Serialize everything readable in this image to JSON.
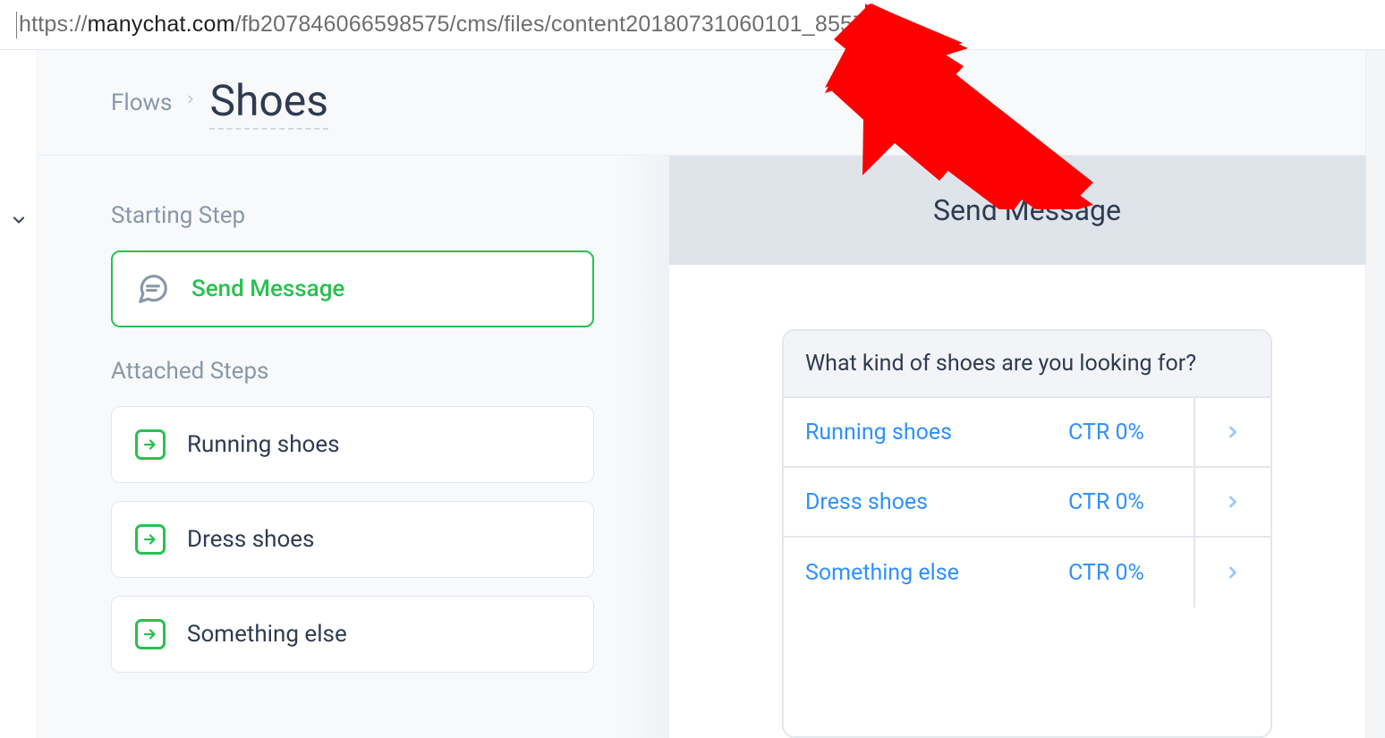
{
  "url": {
    "protocol": "https://",
    "host": "manychat.com",
    "path": "/fb207846066598575/cms/files/content20180731060101_855794"
  },
  "breadcrumb": {
    "parent": "Flows",
    "title": "Shoes"
  },
  "left_panel": {
    "starting_label": "Starting Step",
    "starting_step": "Send Message",
    "attached_label": "Attached Steps",
    "steps": [
      {
        "label": "Running shoes"
      },
      {
        "label": "Dress shoes"
      },
      {
        "label": "Something else"
      }
    ]
  },
  "right_panel": {
    "header": "Send Message",
    "prompt": "What kind of shoes are you looking for?",
    "options": [
      {
        "label": "Running shoes",
        "ctr": "CTR 0%"
      },
      {
        "label": "Dress shoes",
        "ctr": "CTR 0%"
      },
      {
        "label": "Something else",
        "ctr": "CTR 0%"
      }
    ]
  }
}
